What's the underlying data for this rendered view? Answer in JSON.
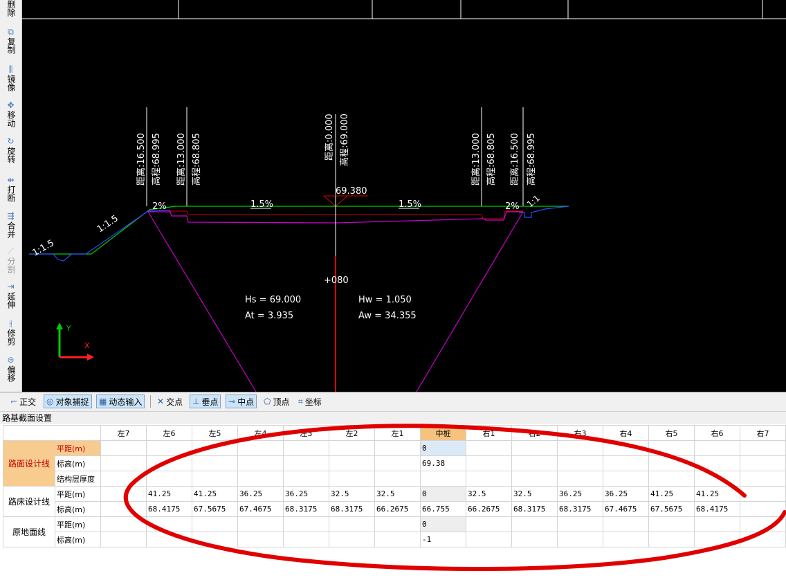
{
  "left_toolbar": [
    {
      "label": "删除",
      "icon": "delete-icon",
      "glyph": "✕",
      "enabled": true
    },
    {
      "label": "复制",
      "icon": "copy-icon",
      "glyph": "⧉",
      "enabled": true
    },
    {
      "label": "镜像",
      "icon": "mirror-icon",
      "glyph": "⫼",
      "enabled": true
    },
    {
      "label": "移动",
      "icon": "move-icon",
      "glyph": "✥",
      "enabled": true
    },
    {
      "label": "旋转",
      "icon": "rotate-icon",
      "glyph": "↻",
      "enabled": true
    },
    {
      "label": "打断",
      "icon": "break-icon",
      "glyph": "⇹",
      "enabled": true
    },
    {
      "label": "合并",
      "icon": "join-icon",
      "glyph": "⇶",
      "enabled": true
    },
    {
      "label": "分割",
      "icon": "split-icon",
      "glyph": "⟋",
      "enabled": false
    },
    {
      "label": "延伸",
      "icon": "extend-icon",
      "glyph": "⇥",
      "enabled": true
    },
    {
      "label": "修剪",
      "icon": "trim-icon",
      "glyph": "⫲",
      "enabled": true
    },
    {
      "label": "偏移",
      "icon": "offset-icon",
      "glyph": "⊜",
      "enabled": true
    }
  ],
  "canvas": {
    "left_outer": {
      "distance": "距离:16.500",
      "elevation": "高程:68.995"
    },
    "left_inner": {
      "distance": "距离:13.000",
      "elevation": "高程:68.805"
    },
    "center": {
      "distance": "距离:0.000",
      "elevation": "高程:69.000",
      "design_elev": "69.380"
    },
    "right_inner": {
      "distance": "距离:13.000",
      "elevation": "高程:68.805"
    },
    "right_outer": {
      "distance": "距离:16.500",
      "elevation": "高程:68.995"
    },
    "slope_left_fill": "1:1.5",
    "slope_left_cut": "1:1.5",
    "slope_right": "1:1",
    "crossfall_left": "1.5%",
    "crossfall_right": "1.5%",
    "shoulder_left": "2%",
    "shoulder_right": "2%",
    "station": "+080",
    "hs": "Hs = 69.000",
    "at": "At = 3.935",
    "hw": "Hw = 1.050",
    "aw": "Aw = 34.355",
    "axis_x": "X",
    "axis_y": "Y"
  },
  "snap_toolbar": {
    "ortho": {
      "label": "正交",
      "icon": "ortho-icon",
      "active": false
    },
    "object_snap": {
      "label": "对象捕捉",
      "icon": "object-snap-icon",
      "active": true
    },
    "dynamic_input": {
      "label": "动态输入",
      "icon": "dynamic-input-icon",
      "active": true
    },
    "intersection": {
      "label": "交点",
      "icon": "intersection-icon",
      "active": false
    },
    "perpendicular": {
      "label": "垂点",
      "icon": "perpendicular-icon",
      "active": true
    },
    "midpoint": {
      "label": "中点",
      "icon": "midpoint-icon",
      "active": true
    },
    "vertex": {
      "label": "顶点",
      "icon": "vertex-icon",
      "active": false
    },
    "coordinate": {
      "label": "坐标",
      "icon": "coordinate-icon",
      "active": false
    }
  },
  "panel": {
    "title": "路基截面设置"
  },
  "table": {
    "columns": [
      "左7",
      "左6",
      "左5",
      "左4",
      "左3",
      "左2",
      "左1",
      "中桩",
      "右1",
      "右2",
      "右3",
      "右4",
      "右5",
      "右6",
      "右7"
    ],
    "groups": [
      {
        "name": "路面设计线",
        "rows": [
          {
            "label": "平距(m)",
            "values": [
              "",
              "",
              "",
              "",
              "",
              "",
              "",
              "0",
              "",
              "",
              "",
              "",
              "",
              "",
              ""
            ]
          },
          {
            "label": "标高(m)",
            "values": [
              "",
              "",
              "",
              "",
              "",
              "",
              "",
              "69.38",
              "",
              "",
              "",
              "",
              "",
              "",
              ""
            ]
          },
          {
            "label": "结构层厚度",
            "values": [
              "",
              "",
              "",
              "",
              "",
              "",
              "",
              "",
              "",
              "",
              "",
              "",
              "",
              "",
              ""
            ]
          }
        ]
      },
      {
        "name": "路床设计线",
        "rows": [
          {
            "label": "平距(m)",
            "values": [
              "",
              "41.25",
              "41.25",
              "36.25",
              "36.25",
              "32.5",
              "32.5",
              "0",
              "32.5",
              "32.5",
              "36.25",
              "36.25",
              "41.25",
              "41.25",
              ""
            ]
          },
          {
            "label": "标高(m)",
            "values": [
              "",
              "68.4175",
              "67.5675",
              "67.4675",
              "68.3175",
              "68.3175",
              "66.2675",
              "66.755",
              "66.2675",
              "68.3175",
              "68.3175",
              "67.4675",
              "67.5675",
              "68.4175",
              ""
            ]
          }
        ]
      },
      {
        "name": "原地面线",
        "rows": [
          {
            "label": "平距(m)",
            "values": [
              "",
              "",
              "",
              "",
              "",
              "",
              "",
              "0",
              "",
              "",
              "",
              "",
              "",
              "",
              ""
            ]
          },
          {
            "label": "标高(m)",
            "values": [
              "",
              "",
              "",
              "",
              "",
              "",
              "",
              "-1",
              "",
              "",
              "",
              "",
              "",
              "",
              ""
            ]
          }
        ]
      }
    ]
  },
  "colors": {
    "canvas_bg": "#000000",
    "surface_line": "#00cc00",
    "subgrade_line": "#cc00cc",
    "structure_line": "#cc0000",
    "ground_line": "#2a4cff",
    "centerline": "#ff0000",
    "annotation": "#e00000",
    "center_header": "#f6c27d"
  }
}
